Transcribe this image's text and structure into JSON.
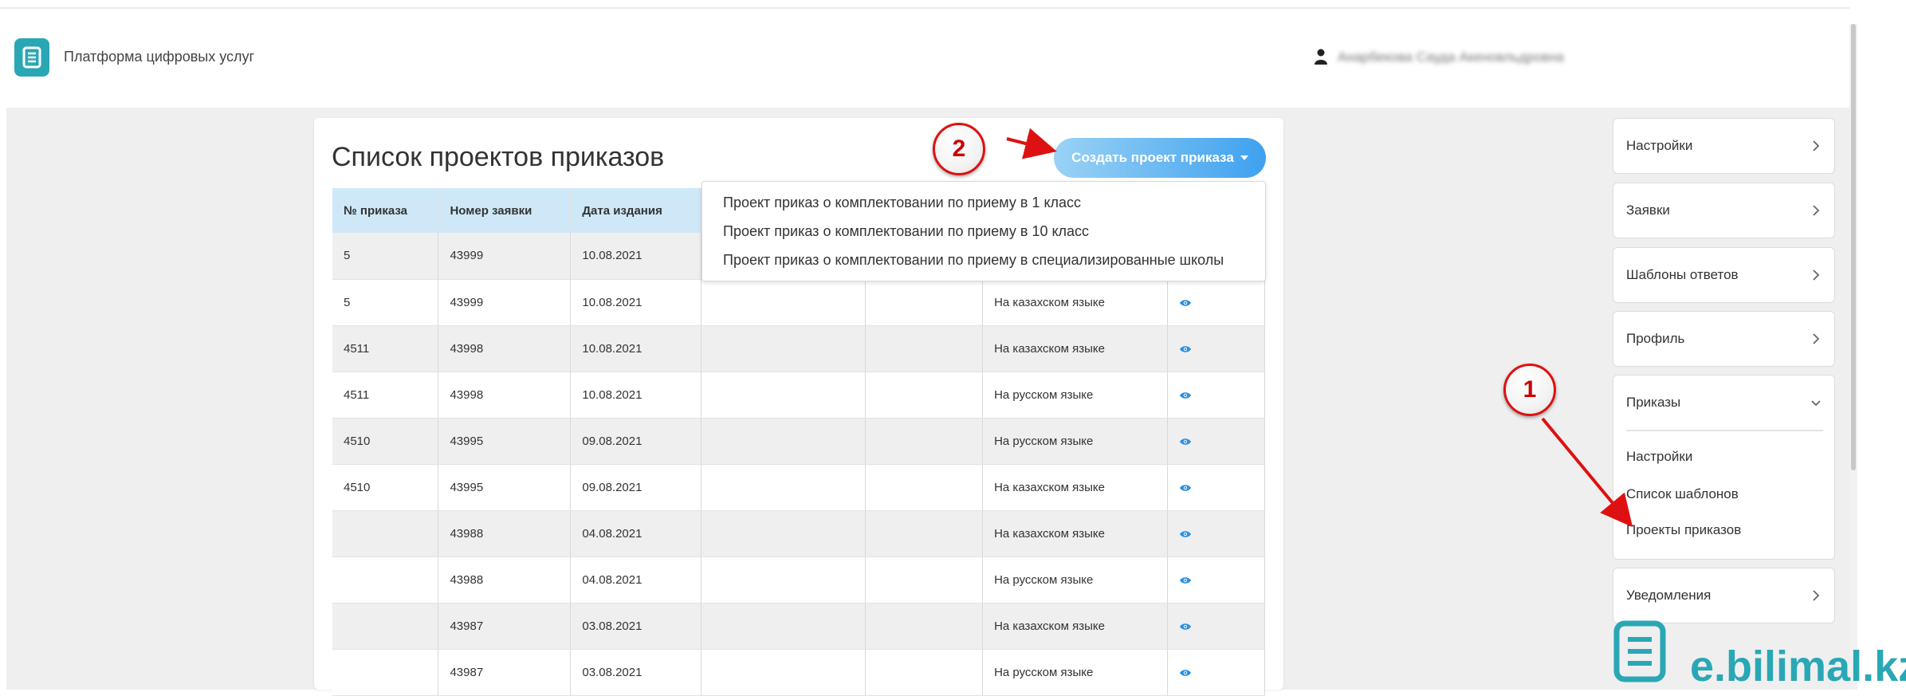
{
  "header": {
    "brand_title": "Платформа цифровых услуг",
    "user_name": "Анарбекова Сауда Акеновльдровна"
  },
  "page": {
    "title": "Список проектов приказов",
    "create_button": "Создать проект приказа"
  },
  "dropdown": {
    "items": [
      "Проект приказ о комплектовании по приему в 1 класс",
      "Проект приказ о комплектовании по приему в 10 класс",
      "Проект приказ о комплектовании по приему в специализированные школы"
    ]
  },
  "table": {
    "headers": [
      "№ приказа",
      "Номер заявки",
      "Дата издания",
      "",
      "",
      "",
      ""
    ],
    "rows": [
      {
        "order": "5",
        "app": "43999",
        "date": "10.08.2021",
        "lang": ""
      },
      {
        "order": "5",
        "app": "43999",
        "date": "10.08.2021",
        "lang": "На казахском языке"
      },
      {
        "order": "4511",
        "app": "43998",
        "date": "10.08.2021",
        "lang": "На казахском языке"
      },
      {
        "order": "4511",
        "app": "43998",
        "date": "10.08.2021",
        "lang": "На русском языке"
      },
      {
        "order": "4510",
        "app": "43995",
        "date": "09.08.2021",
        "lang": "На русском языке"
      },
      {
        "order": "4510",
        "app": "43995",
        "date": "09.08.2021",
        "lang": "На казахском языке"
      },
      {
        "order": "",
        "app": "43988",
        "date": "04.08.2021",
        "lang": "На казахском языке"
      },
      {
        "order": "",
        "app": "43988",
        "date": "04.08.2021",
        "lang": "На русском языке"
      },
      {
        "order": "",
        "app": "43987",
        "date": "03.08.2021",
        "lang": "На казахском языке"
      },
      {
        "order": "",
        "app": "43987",
        "date": "03.08.2021",
        "lang": "На русском языке"
      }
    ]
  },
  "sidebar": {
    "items": [
      "Настройки",
      "Заявки",
      "Шаблоны ответов",
      "Профиль"
    ],
    "group": {
      "title": "Приказы",
      "subitems": [
        "Настройки",
        "Список шаблонов",
        "Проекты приказов"
      ]
    },
    "notifications": "Уведомления"
  },
  "footer_logo": "e.bilimal.kz",
  "annotations": [
    "1",
    "2"
  ],
  "colors": {
    "accent": "#2aa7b5",
    "button": "#3ea1ef",
    "table_header": "#cfe8f8",
    "annotation": "#dd1111"
  }
}
